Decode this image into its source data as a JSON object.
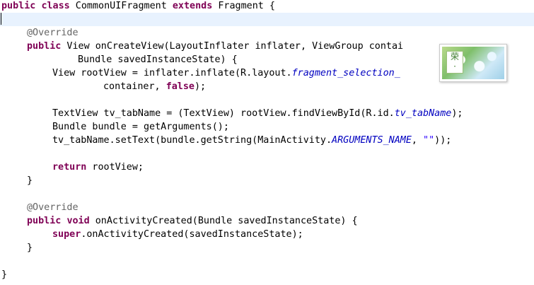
{
  "editor": {
    "lines": [
      {
        "indent": 0,
        "tokens": [
          [
            "kw",
            "public"
          ],
          [
            "t",
            " "
          ],
          [
            "kw",
            "class"
          ],
          [
            "t",
            " CommonUIFragment "
          ],
          [
            "kw",
            "extends"
          ],
          [
            "t",
            " Fragment {"
          ]
        ]
      },
      {
        "indent": 0,
        "tokens": [],
        "current": true
      },
      {
        "indent": 1,
        "tokens": [
          [
            "ann",
            "@Override"
          ]
        ]
      },
      {
        "indent": 1,
        "tokens": [
          [
            "kw",
            "public"
          ],
          [
            "t",
            " View onCreateView(LayoutInflater inflater, ViewGroup contai"
          ]
        ]
      },
      {
        "indent": 3,
        "tokens": [
          [
            "t",
            "Bundle savedInstanceState) {"
          ]
        ]
      },
      {
        "indent": 2,
        "tokens": [
          [
            "t",
            "View rootView = inflater.inflate(R.layout."
          ],
          [
            "fld",
            "fragment_selection_"
          ]
        ]
      },
      {
        "indent": 4,
        "tokens": [
          [
            "t",
            "container, "
          ],
          [
            "kw",
            "false"
          ],
          [
            "t",
            ");"
          ]
        ]
      },
      {
        "indent": 0,
        "tokens": []
      },
      {
        "indent": 2,
        "tokens": [
          [
            "t",
            "TextView tv_tabName = (TextView) rootView.findViewById(R.id."
          ],
          [
            "fld",
            "tv_tabName"
          ],
          [
            "t",
            ");"
          ]
        ]
      },
      {
        "indent": 2,
        "tokens": [
          [
            "t",
            "Bundle bundle = getArguments();"
          ]
        ]
      },
      {
        "indent": 2,
        "tokens": [
          [
            "t",
            "tv_tabName.setText(bundle.getString(MainActivity."
          ],
          [
            "fld",
            "ARGUMENTS_NAME"
          ],
          [
            "t",
            ", "
          ],
          [
            "str",
            "\"\""
          ],
          [
            "t",
            "));"
          ]
        ]
      },
      {
        "indent": 0,
        "tokens": []
      },
      {
        "indent": 2,
        "tokens": [
          [
            "kw",
            "return"
          ],
          [
            "t",
            " rootView;"
          ]
        ]
      },
      {
        "indent": 1,
        "tokens": [
          [
            "t",
            "}"
          ]
        ]
      },
      {
        "indent": 0,
        "tokens": []
      },
      {
        "indent": 1,
        "tokens": [
          [
            "ann",
            "@Override"
          ]
        ]
      },
      {
        "indent": 1,
        "tokens": [
          [
            "kw",
            "public"
          ],
          [
            "t",
            " "
          ],
          [
            "kw",
            "void"
          ],
          [
            "t",
            " onActivityCreated(Bundle savedInstanceState) {"
          ]
        ]
      },
      {
        "indent": 2,
        "tokens": [
          [
            "kw",
            "super"
          ],
          [
            "t",
            ".onActivityCreated(savedInstanceState);"
          ]
        ]
      },
      {
        "indent": 1,
        "tokens": [
          [
            "t",
            "}"
          ]
        ]
      },
      {
        "indent": 0,
        "tokens": []
      },
      {
        "indent": 0,
        "tokens": [
          [
            "t",
            "}"
          ]
        ]
      }
    ]
  },
  "popup": {
    "stamp_text": "荣\n·"
  },
  "colors": {
    "keyword": "#7f0055",
    "annotation": "#646464",
    "field": "#0000c0",
    "string": "#2a00ff",
    "current_line": "#e8f2fe"
  }
}
